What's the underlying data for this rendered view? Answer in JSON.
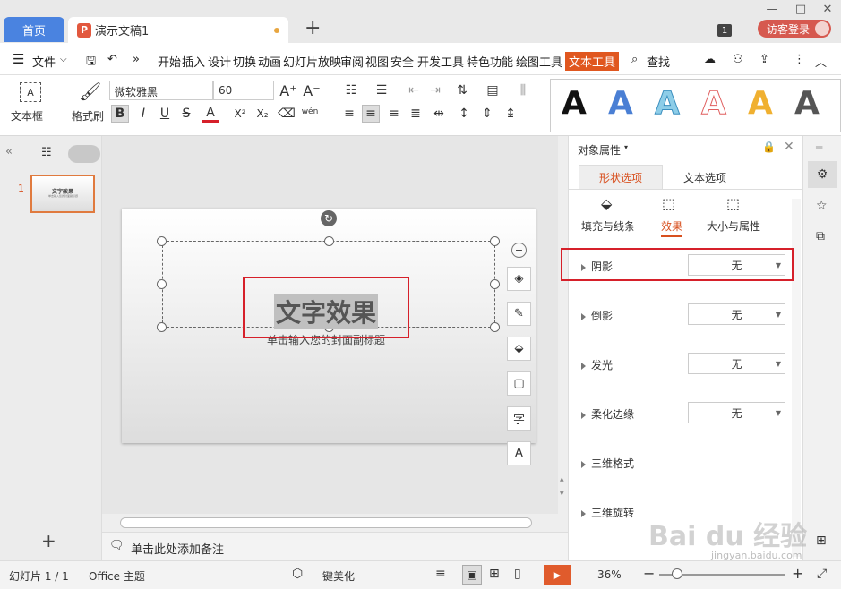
{
  "tabs": {
    "home": "首页",
    "doc": "演示文稿1"
  },
  "window": {
    "min": "—",
    "max": "□",
    "close": "✕",
    "login": "访客登录",
    "badge": "1"
  },
  "menu": {
    "file": "文件",
    "items": [
      "开始",
      "插入",
      "设计",
      "切换",
      "动画",
      "幻灯片放映",
      "审阅",
      "视图",
      "安全",
      "开发工具",
      "特色功能",
      "绘图工具"
    ],
    "active": "文本工具",
    "search": "查找"
  },
  "ribbon": {
    "textbox": "文本框",
    "format_painter": "格式刷",
    "font_name": "微软雅黑",
    "font_size": "60",
    "bold": "B",
    "italic": "I",
    "underline": "U",
    "strike": "S",
    "color_a": "A",
    "sup": "X²",
    "sub": "X₂",
    "eraser": "⌫",
    "phonetic": "wén",
    "styles": [
      "A",
      "A",
      "A",
      "A",
      "A",
      "A"
    ]
  },
  "leftpanel": {
    "slide_num": "1",
    "thumb_title": "文字效果",
    "thumb_sub": "单击输入您的封面副标题"
  },
  "slide": {
    "title": "文字效果",
    "subtitle": "单击输入您的封面副标题"
  },
  "notes": "单击此处添加备注",
  "panel": {
    "title": "对象属性",
    "tab_shape": "形状选项",
    "tab_text": "文本选项",
    "sub_fill": "填充与线条",
    "sub_effect": "效果",
    "sub_size": "大小与属性",
    "rows": [
      "阴影",
      "倒影",
      "发光",
      "柔化边缘",
      "三维格式",
      "三维旋转"
    ],
    "none": "无"
  },
  "status": {
    "slide": "幻灯片 1 / 1",
    "theme": "Office 主题",
    "beautify": "一键美化",
    "zoom": "36%"
  },
  "watermark": {
    "brand": "Bai du 经验",
    "url": "jingyan.baidu.com"
  }
}
